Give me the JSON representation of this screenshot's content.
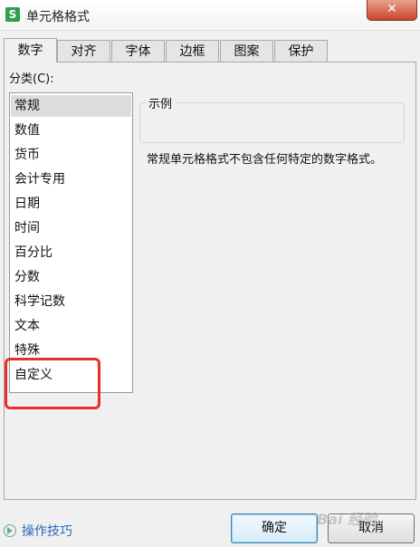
{
  "window": {
    "title": "单元格格式",
    "app_icon_letter": "S",
    "close_glyph": "✕"
  },
  "tabs": [
    {
      "label": "数字",
      "active": true
    },
    {
      "label": "对齐",
      "active": false
    },
    {
      "label": "字体",
      "active": false
    },
    {
      "label": "边框",
      "active": false
    },
    {
      "label": "图案",
      "active": false
    },
    {
      "label": "保护",
      "active": false
    }
  ],
  "category": {
    "label": "分类(C):",
    "selected": "常规",
    "items": [
      "常规",
      "数值",
      "货币",
      "会计专用",
      "日期",
      "时间",
      "百分比",
      "分数",
      "科学记数",
      "文本",
      "特殊",
      "自定义"
    ]
  },
  "sample": {
    "label": "示例",
    "value": ""
  },
  "description": "常规单元格格式不包含任何特定的数字格式。",
  "footer": {
    "tips_label": "操作技巧",
    "ok_label": "确定",
    "cancel_label": "取消"
  },
  "overlay": {
    "highlight_color": "#e8302a",
    "watermark_text": "Bai 经验"
  },
  "colors": {
    "app_icon": "#2e9e51",
    "close_button": "#c8452a",
    "link": "#2a6ab8"
  },
  "icons": {
    "app": "wps-spreadsheet-icon",
    "tips": "play-circle-icon",
    "close": "close-icon"
  }
}
